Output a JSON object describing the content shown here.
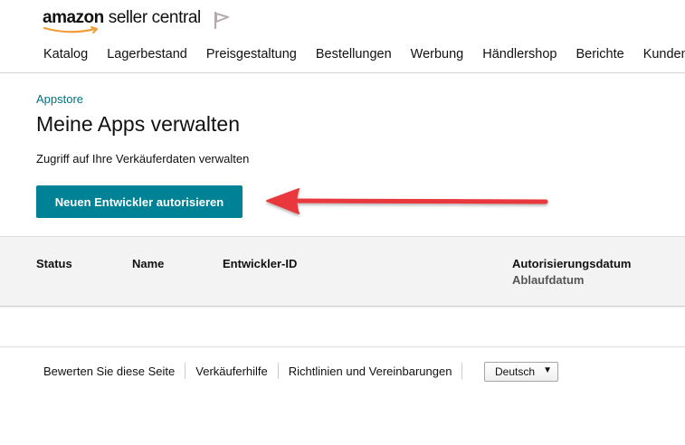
{
  "header": {
    "logo_brand": "amazon",
    "logo_product": "seller central",
    "flag_icon": "flag-icon",
    "nav": [
      {
        "label": "Katalog"
      },
      {
        "label": "Lagerbestand"
      },
      {
        "label": "Preisgestaltung"
      },
      {
        "label": "Bestellungen"
      },
      {
        "label": "Werbung"
      },
      {
        "label": "Händlershop"
      },
      {
        "label": "Berichte"
      },
      {
        "label": "Kundenz"
      }
    ]
  },
  "main": {
    "breadcrumb": "Appstore",
    "title": "Meine Apps verwalten",
    "subtitle": "Zugriff auf Ihre Verkäuferdaten verwalten",
    "authorize_button": "Neuen Entwickler autorisieren",
    "button_color": "#008296",
    "arrow_color": "#e8383d"
  },
  "table": {
    "columns": {
      "status": "Status",
      "name": "Name",
      "developer_id": "Entwickler-ID",
      "authorization_date": "Autorisierungsdatum",
      "expiry_date": "Ablaufdatum"
    },
    "rows": []
  },
  "footer": {
    "links": [
      {
        "label": "Bewerten Sie diese Seite"
      },
      {
        "label": "Verkäuferhilfe"
      },
      {
        "label": "Richtlinien und Vereinbarungen"
      }
    ],
    "language_selected": "Deutsch"
  }
}
